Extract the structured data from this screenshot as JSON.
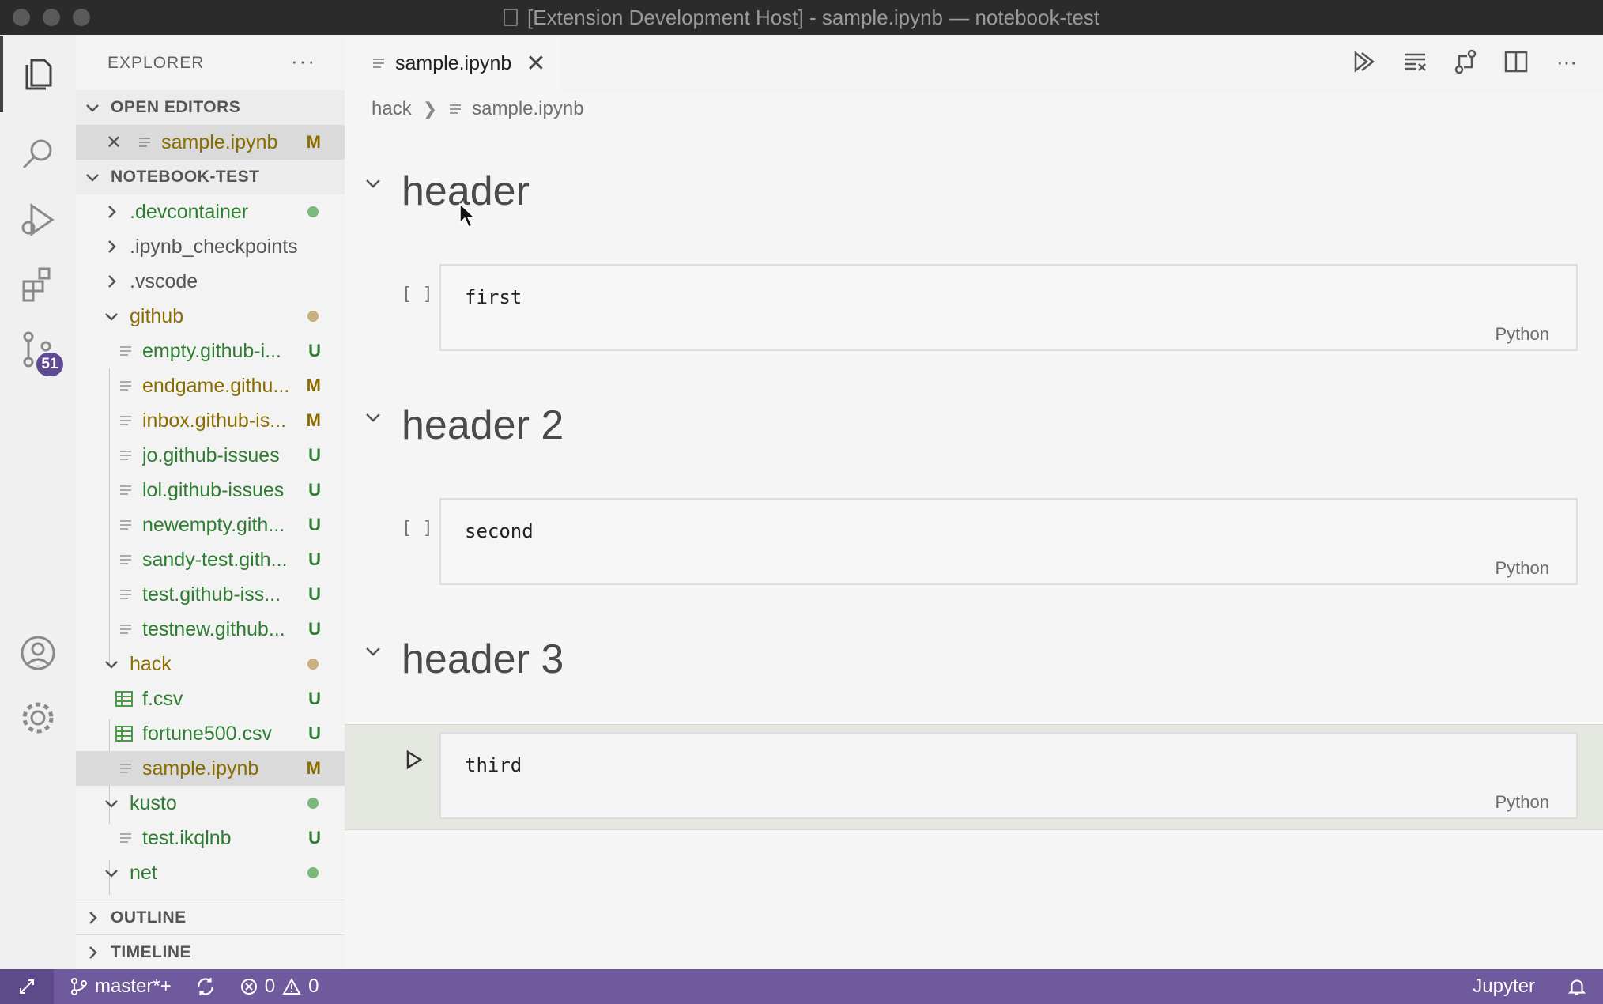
{
  "window": {
    "title": "[Extension Development Host] - sample.ipynb — notebook-test"
  },
  "activity": {
    "scm_badge": "51"
  },
  "sidebar": {
    "title": "EXPLORER",
    "more": "···",
    "open_editors": {
      "header": "OPEN EDITORS",
      "items": [
        {
          "name": "sample.ipynb",
          "status": "M"
        }
      ]
    },
    "workspace": {
      "header": "NOTEBOOK-TEST",
      "items": [
        {
          "name": ".devcontainer",
          "status": ""
        },
        {
          "name": ".ipynb_checkpoints",
          "status": ""
        },
        {
          "name": ".vscode",
          "status": ""
        },
        {
          "name": "github",
          "status": ""
        },
        {
          "name": "empty.github-i...",
          "status": "U"
        },
        {
          "name": "endgame.githu...",
          "status": "M"
        },
        {
          "name": "inbox.github-is...",
          "status": "M"
        },
        {
          "name": "jo.github-issues",
          "status": "U"
        },
        {
          "name": "lol.github-issues",
          "status": "U"
        },
        {
          "name": "newempty.gith...",
          "status": "U"
        },
        {
          "name": "sandy-test.gith...",
          "status": "U"
        },
        {
          "name": "test.github-iss...",
          "status": "U"
        },
        {
          "name": "testnew.github...",
          "status": "U"
        },
        {
          "name": "hack",
          "status": ""
        },
        {
          "name": "f.csv",
          "status": "U"
        },
        {
          "name": "fortune500.csv",
          "status": "U"
        },
        {
          "name": "sample.ipynb",
          "status": "M"
        },
        {
          "name": "kusto",
          "status": ""
        },
        {
          "name": "test.ikqlnb",
          "status": "U"
        },
        {
          "name": "net",
          "status": ""
        }
      ]
    },
    "outline": "OUTLINE",
    "timeline": "TIMELINE"
  },
  "editor": {
    "tab": {
      "label": "sample.ipynb",
      "close": "✕"
    },
    "breadcrumb": {
      "folder": "hack",
      "file": "sample.ipynb"
    },
    "cells": [
      {
        "heading": "header",
        "exec": "[ ]",
        "code": "first",
        "lang": "Python"
      },
      {
        "heading": "header 2",
        "exec": "[ ]",
        "code": "second",
        "lang": "Python"
      },
      {
        "heading": "header 3",
        "exec": "",
        "code": "third",
        "lang": "Python"
      }
    ]
  },
  "status": {
    "branch": "master*+",
    "errors": "0",
    "warnings": "0",
    "kernel": "Jupyter"
  },
  "colors": {
    "accent": "#6f5a9e",
    "modified": "#8a6d00",
    "untracked": "#2e7d32"
  }
}
